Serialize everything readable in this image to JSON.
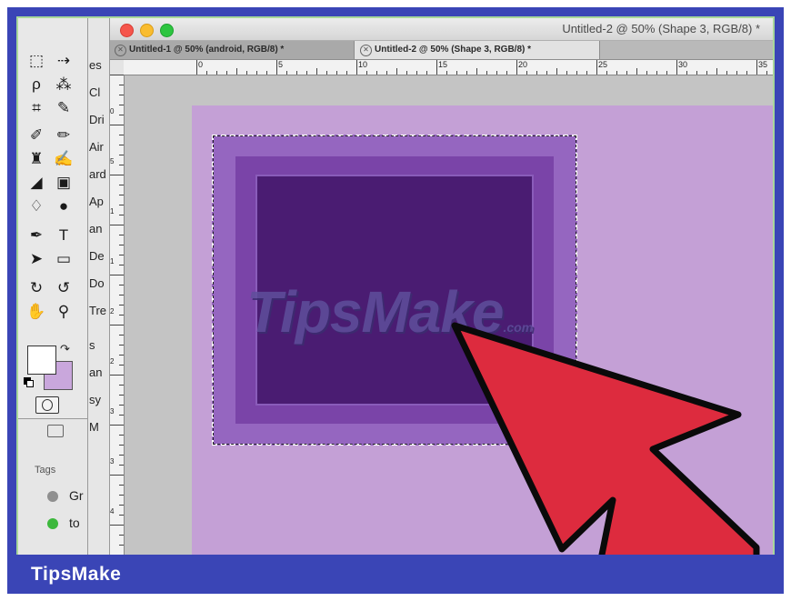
{
  "window": {
    "title": "Untitled-2 @ 50% (Shape 3, RGB/8) *"
  },
  "tabs": [
    {
      "label": "Untitled-1 @ 50% (android, RGB/8) *",
      "active": false
    },
    {
      "label": "Untitled-2 @ 50% (Shape 3, RGB/8) *",
      "active": true
    }
  ],
  "ruler": {
    "top_labels": [
      "0",
      "5",
      "10",
      "15",
      "20",
      "25",
      "30",
      "35"
    ],
    "left_labels": [
      "0",
      "5",
      "1",
      "1",
      "2",
      "2",
      "3",
      "3",
      "4"
    ]
  },
  "side_panel": {
    "items": [
      "es",
      "Cl",
      "Dri",
      "Air",
      "ard",
      "Ap",
      "an",
      "De",
      "Do",
      "Tre",
      "s",
      "an",
      "sy",
      "M"
    ],
    "tags_label": "Tags",
    "tags": [
      {
        "label": "Gr",
        "color": "#8f8f8f"
      },
      {
        "label": "to",
        "color": "#3cb83c"
      }
    ]
  },
  "colors": {
    "foreground": "#ffffff",
    "background": "#c9a7dc",
    "arrow": "#dd2b3e",
    "document": "#c4a0d6",
    "shape": "#4a1c72"
  },
  "watermark": {
    "text": "TipsMake",
    "suffix": ".com"
  },
  "brand": {
    "name": "TipsMake"
  },
  "icons": [
    "marquee-icon",
    "move-icon",
    "lasso-icon",
    "magic-wand-icon",
    "crop-icon",
    "eyedropper-icon",
    "healing-brush-icon",
    "brush-icon",
    "clone-stamp-icon",
    "history-brush-icon",
    "eraser-icon",
    "gradient-icon",
    "blur-icon",
    "dodge-icon",
    "pen-icon",
    "type-icon",
    "path-selection-icon",
    "shape-icon",
    "3d-rotate-icon",
    "3d-pan-icon",
    "hand-icon",
    "zoom-icon",
    "swap-colors-icon",
    "default-colors-icon",
    "quick-mask-icon",
    "close-icon",
    "cursor-arrow-icon"
  ]
}
